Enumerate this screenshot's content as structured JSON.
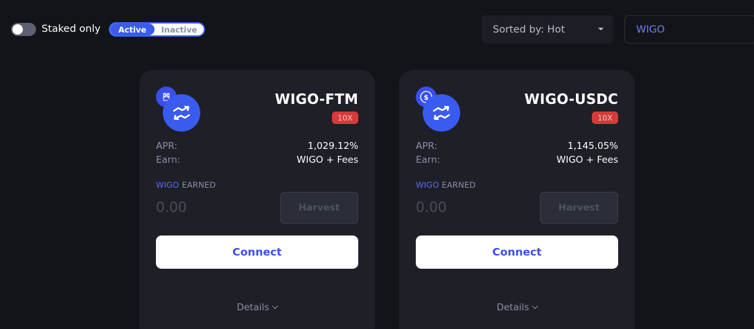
{
  "filters": {
    "staked_only_label": "Staked only",
    "staked_only_on": false,
    "segment": {
      "active_label": "Active",
      "inactive_label": "Inactive",
      "selected": "Active"
    },
    "sort_label": "Sorted by: Hot",
    "search_value": "WIGO"
  },
  "colors": {
    "accent": "#3a5bf0",
    "badge_red": "#d63a3a",
    "card_bg": "#1e1f27",
    "page_bg": "#131419"
  },
  "farms": [
    {
      "pair": "WIGO-FTM",
      "multiplier": "10X",
      "apr_label": "APR:",
      "apr_value": "1,029.12%",
      "earn_label": "Earn:",
      "earn_value": "WIGO + Fees",
      "earned_token": "WIGO",
      "earned_suffix": "EARNED",
      "earned_value": "0.00",
      "harvest_label": "Harvest",
      "connect_label": "Connect",
      "details_label": "Details",
      "quote_icon": "fantom-icon"
    },
    {
      "pair": "WIGO-USDC",
      "multiplier": "10X",
      "apr_label": "APR:",
      "apr_value": "1,145.05%",
      "earn_label": "Earn:",
      "earn_value": "WIGO + Fees",
      "earned_token": "WIGO",
      "earned_suffix": "EARNED",
      "earned_value": "0.00",
      "harvest_label": "Harvest",
      "connect_label": "Connect",
      "details_label": "Details",
      "quote_icon": "usdc-icon"
    }
  ]
}
